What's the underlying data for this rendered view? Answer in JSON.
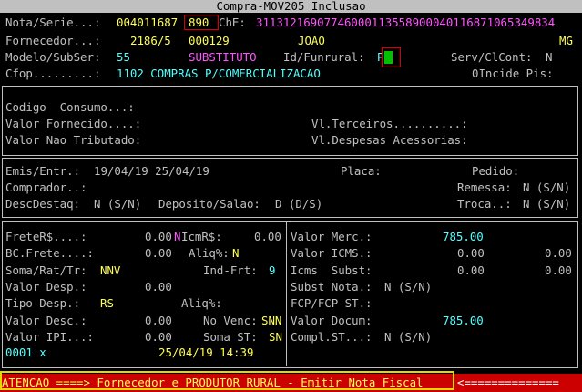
{
  "window": {
    "title": "Compra-MOV205  Inclusao"
  },
  "header": {
    "nota_label": "Nota/Serie...:",
    "nota_value": "004011687",
    "serie_value": "890",
    "chave_label": "ChE:",
    "chave_value": "31131216907746000113558900040116871065349834",
    "fornecedor_label": "Fornecedor...:",
    "fornecedor_code": "2186/5",
    "fornecedor_num": "000129",
    "fornecedor_name": "JOAO",
    "fornecedor_uf": "MG",
    "modelo_label": "Modelo/SubSer:",
    "modelo_value": "55",
    "subser_value": "SUBSTITUTO",
    "funrural_label": "Id/Funrural:",
    "funrural_value": "P",
    "serv_label": "Serv/ClCont:",
    "serv_value": "N",
    "cfop_label": "Cfop.........:",
    "cfop_value": "1102 COMPRAS P/COMERCIALIZACAO",
    "incide_label": "0Incide Pis:"
  },
  "values_section": {
    "codigo_consumo": "Codigo  Consumo...:",
    "valor_fornecido": "Valor Fornecido....:",
    "valor_nao_tributado": "Valor Nao Tributado:",
    "vl_terceiros": "Vl.Terceiros..........:",
    "vl_despesas": "Vl.Despesas Acessorias:"
  },
  "dates_section": {
    "emis_label": "Emis/Entr.:",
    "emis_value": "19/04/19 25/04/19",
    "placa_label": "Placa:",
    "pedido_label": "Pedido:",
    "comprador_label": "Comprador..:",
    "remessa_label": "Remessa:",
    "remessa_value": "N (S/N)",
    "desc_label": "DescDestaq:",
    "desc_value": "N (S/N)",
    "deposito_label": "Deposito/Salao:",
    "deposito_value": "D (D/S)",
    "troca_label": "Troca..:",
    "troca_value": "N (S/N)"
  },
  "left_panel": {
    "frete_label": "FreteR$....:",
    "frete_value": "0.00",
    "icmr_flag": "N",
    "icmr_label": "IcmR$:",
    "icmr_value": "0.00",
    "bcfrete_label": "BC.Frete....:",
    "bcfrete_value": "0.00",
    "aliq_label": "Aliq%:",
    "aliq_value": "N",
    "soma_label": "Soma/Rat/Tr:",
    "soma_value": "NNV",
    "indfrt_label": "Ind-Frt:",
    "indfrt_value": "9",
    "valor_desp_label": "Valor Desp.:",
    "valor_desp_value": "0.00",
    "tipo_desp_label": "Tipo Desp.:",
    "tipo_desp_value": "RS",
    "aliq2_label": "Aliq%:",
    "valor_desc_label": "Valor Desc.:",
    "valor_desc_value": "0.00",
    "novenc_label": "No Venc:",
    "novenc_value": "SNN",
    "valor_ipi_label": "Valor IPI...:",
    "valor_ipi_value": "0.00",
    "somast_label": "Soma ST:",
    "somast_value": "SN",
    "record_value": "0001 x",
    "record_date": "25/04/19 14:39"
  },
  "right_panel": {
    "merc_label": "Valor Merc.:",
    "merc_value": "785.00",
    "icms_label": "Valor ICMS.:",
    "icms_value1": "0.00",
    "icms_value2": "0.00",
    "subst_label": "Icms  Subst:",
    "subst_value1": "0.00",
    "subst_value2": "0.00",
    "subst_nota_label": "Subst Nota.:",
    "subst_nota_value": "N (S/N)",
    "fcp_label": "FCP/FCP ST.:",
    "docum_label": "Valor Docum:",
    "docum_value": "785.00",
    "compl_label": "Compl.ST...:",
    "compl_value": "N (S/N)"
  },
  "status": {
    "message": "ATENCAO ====> Fornecedor e PRODUTOR RURAL - Emitir Nota Fiscal",
    "arrow": "<=============="
  },
  "colors": {
    "background": "#000000",
    "label": "#c0c0c0",
    "value": "#ffff55",
    "highlight": "#ff55ff",
    "accent": "#55ffff",
    "status_bg": "#cc0000",
    "status_border": "#e6d600"
  }
}
